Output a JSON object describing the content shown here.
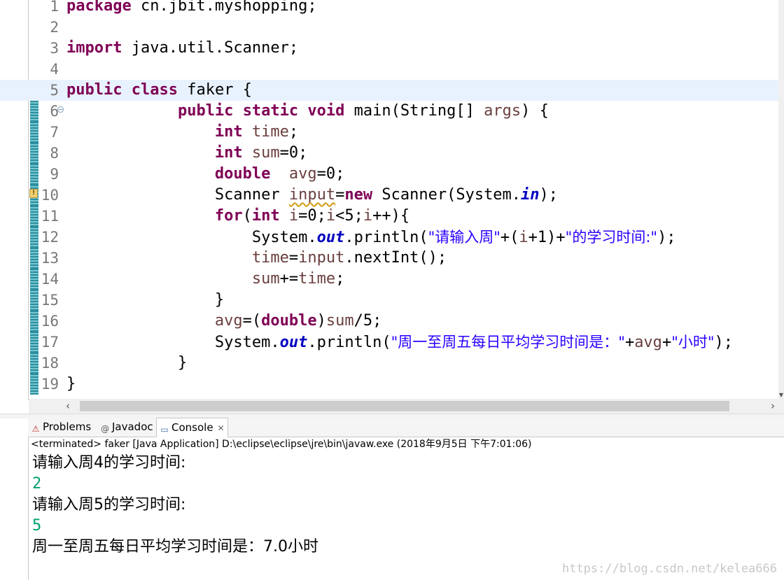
{
  "editor": {
    "lines": [
      {
        "n": "1",
        "html": "<span class=\"kw\">package</span> cn.jbit.myshopping;"
      },
      {
        "n": "2",
        "html": ""
      },
      {
        "n": "3",
        "html": "<span class=\"kw\">import</span> java.util.Scanner;"
      },
      {
        "n": "4",
        "html": ""
      },
      {
        "n": "5",
        "html": "<span class=\"kw\">public</span> <span class=\"kw\">class</span> faker {",
        "highlighted": true,
        "changed": true
      },
      {
        "n": "6",
        "html": "            <span class=\"kw\">public</span> <span class=\"kw\">static</span> <span class=\"kw\">void</span> main(String[] <span class=\"var\">args</span>) {",
        "changed": true,
        "fold": true
      },
      {
        "n": "7",
        "html": "                <span class=\"kw\">int</span> <span class=\"var\">time</span>;",
        "changed": true
      },
      {
        "n": "8",
        "html": "                <span class=\"kw\">int</span> <span class=\"var\">sum</span>=0;",
        "changed": true
      },
      {
        "n": "9",
        "html": "                <span class=\"kw\">double</span>  <span class=\"var\">avg</span>=0;",
        "changed": true
      },
      {
        "n": "10",
        "html": "                Scanner <span class=\"var warn-ul\">input</span>=<span class=\"kw\">new</span> Scanner(System.<span class=\"st\">in</span>);",
        "changed": true,
        "warning": true
      },
      {
        "n": "11",
        "html": "                <span class=\"kw\">for</span>(<span class=\"kw\">int</span> <span class=\"var\">i</span>=0;<span class=\"var\">i</span>&lt;5;<span class=\"var\">i</span>++){",
        "changed": true
      },
      {
        "n": "12",
        "html": "                    System.<span class=\"st\">out</span>.println(<span class=\"str\">\"请输入周\"</span>+(<span class=\"var\">i</span>+1)+<span class=\"str\">\"的学习时间:\"</span>);",
        "changed": true
      },
      {
        "n": "13",
        "html": "                    <span class=\"var\">time</span>=<span class=\"var\">input</span>.nextInt();",
        "changed": true
      },
      {
        "n": "14",
        "html": "                    <span class=\"var\">sum</span>+=<span class=\"var\">time</span>;",
        "changed": true
      },
      {
        "n": "15",
        "html": "                }",
        "changed": true
      },
      {
        "n": "16",
        "html": "                <span class=\"var\">avg</span>=(<span class=\"kw\">double</span>)<span class=\"var\">sum</span>/5;",
        "changed": true
      },
      {
        "n": "17",
        "html": "                System.<span class=\"st\">out</span>.println(<span class=\"str\">\"周一至周五每日平均学习时间是：\"</span>+<span class=\"var\">avg</span>+<span class=\"str\">\"小时\"</span>);",
        "changed": true
      },
      {
        "n": "18",
        "html": "            }",
        "changed": true
      },
      {
        "n": "19",
        "html": "}",
        "changed": true
      }
    ]
  },
  "tabs": [
    {
      "label": "Problems",
      "icon": "problems-icon",
      "glyph": "⚠",
      "active": false
    },
    {
      "label": "Javadoc",
      "icon": "javadoc-icon",
      "glyph": "@",
      "active": false
    },
    {
      "label": "Console",
      "icon": "console-icon",
      "glyph": "▭",
      "active": true
    }
  ],
  "console": {
    "status": "<terminated> faker [Java Application] D:\\eclipse\\eclipse\\jre\\bin\\javaw.exe (2018年9月5日 下午7:01:06)",
    "output": [
      {
        "text": "请输入周4的学习时间:",
        "kind": "stdout"
      },
      {
        "text": "2",
        "kind": "stdin"
      },
      {
        "text": "请输入周5的学习时间:",
        "kind": "stdout"
      },
      {
        "text": "5",
        "kind": "stdin"
      },
      {
        "text": "周一至周五每日平均学习时间是：7.0小时",
        "kind": "stdout"
      }
    ]
  },
  "watermark": "https://blog.csdn.net/kelea666",
  "colors": {
    "keyword": "#7f0055",
    "string": "#2a00ff",
    "variable": "#6a3e3e",
    "static_field": "#0000c0",
    "stdin": "#00a070",
    "current_line": "#e8f2fe"
  }
}
